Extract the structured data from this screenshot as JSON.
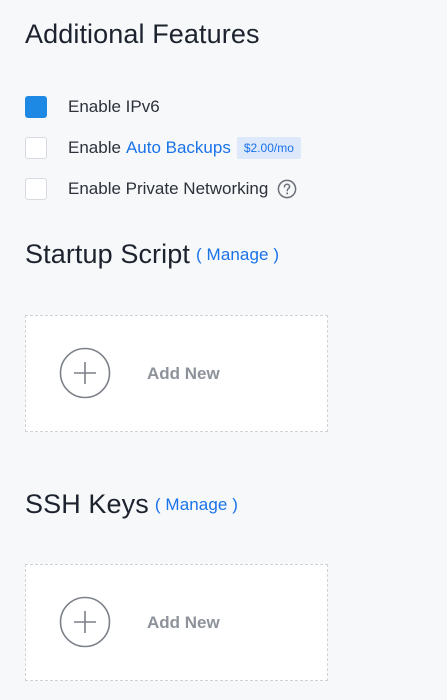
{
  "features": {
    "title": "Additional Features",
    "options": [
      {
        "label": "Enable IPv6",
        "checked": true
      },
      {
        "label": "Enable",
        "link": "Auto Backups",
        "badge": "$2.00/mo",
        "checked": false
      },
      {
        "label": "Enable Private Networking",
        "checked": false,
        "help_icon": "question-circle-icon"
      }
    ]
  },
  "startup_script": {
    "title": "Startup Script",
    "manage": "( Manage )",
    "add_label": "Add New",
    "add_icon": "plus-circle-icon"
  },
  "ssh_keys": {
    "title": "SSH Keys",
    "manage": "( Manage )",
    "add_label": "Add New",
    "add_icon": "plus-circle-icon"
  },
  "colors": {
    "accent": "#1e88e5",
    "link": "#1a73e8",
    "badge_bg": "#dde9fb",
    "muted": "#8e939b"
  }
}
